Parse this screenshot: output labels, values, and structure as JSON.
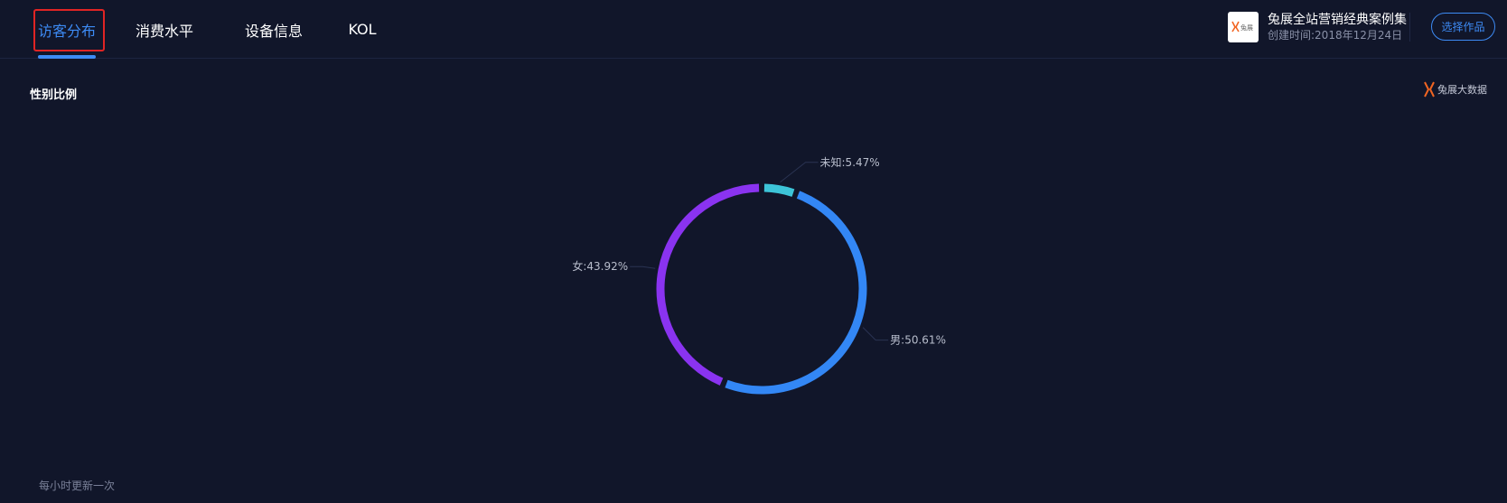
{
  "tabs": [
    {
      "label": "访客分布",
      "active": true
    },
    {
      "label": "消费水平",
      "active": false
    },
    {
      "label": "设备信息",
      "active": false
    },
    {
      "label": "KOL",
      "active": false
    }
  ],
  "work": {
    "logo_text": "兔展",
    "title": "兔展全站营销经典案例集",
    "created": "创建时间:2018年12月24日"
  },
  "select_button": "选择作品",
  "section_title": "性别比例",
  "brand": {
    "text": "兔展大数据",
    "icon": "rabbit-logo-icon",
    "color": "#f26522"
  },
  "chart_data": {
    "type": "pie",
    "variant": "ring",
    "title": "",
    "slices": [
      {
        "name": "未知",
        "label": "未知:5.47%",
        "value": 5.47,
        "color": "#3dc4d8"
      },
      {
        "name": "男",
        "label": "男:50.61%",
        "value": 50.61,
        "color": "#3387f5"
      },
      {
        "name": "女",
        "label": "女:43.92%",
        "value": 43.92,
        "color": "#8a33f0"
      }
    ]
  },
  "footer_note": "每小时更新一次",
  "colors": {
    "background": "#11162a",
    "accent": "#3d8bf5",
    "highlight_box": "#e02424"
  }
}
